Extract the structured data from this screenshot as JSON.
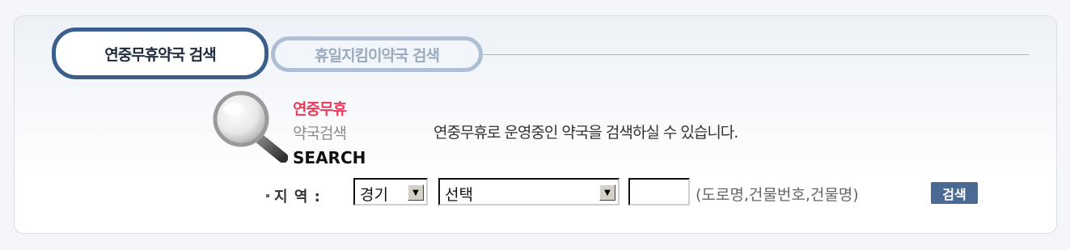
{
  "tabs": {
    "active": "연중무휴약국 검색",
    "inactive": "휴일지킴이약국 검색"
  },
  "logo": {
    "line1": "연중무휴",
    "line2": "약국검색",
    "line3": "SEARCH",
    "icon": "magnifier-icon"
  },
  "description": "연중무휴로 운영중인 약국을 검색하실 수 있습니다.",
  "form": {
    "region_label": "지 역 :",
    "province_value": "경기",
    "city_value": "선택",
    "address_value": "",
    "hint": "(도로명,건물번호,건물명)",
    "search_label": "검색"
  },
  "colors": {
    "accent_pink": "#ee3a5a",
    "tab_border_active": "#3a5f8d",
    "tab_border_inactive": "#aebfd5",
    "button_bg": "#4a6a93"
  }
}
